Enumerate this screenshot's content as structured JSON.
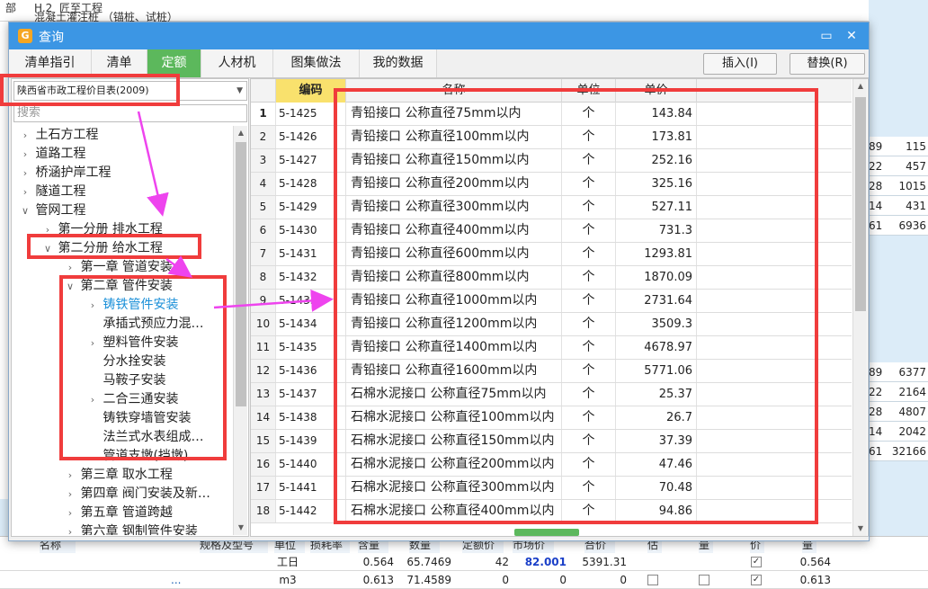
{
  "background": {
    "top_row": {
      "part1": "部",
      "part2": "H.2",
      "part3": "匠至工程",
      "subtitle": "混凝土灌注桩 （锚桩、试桩）"
    },
    "right_values": [
      {
        "a": "89",
        "b": "115"
      },
      {
        "a": "22",
        "b": "457"
      },
      {
        "a": "28",
        "b": "1015"
      },
      {
        "a": "14",
        "b": "431"
      },
      {
        "a": "61",
        "b": "6936"
      }
    ],
    "right_values_lower": [
      {
        "a": "89",
        "b": "6377"
      },
      {
        "a": "22",
        "b": "2164"
      },
      {
        "a": "28",
        "b": "4807"
      },
      {
        "a": "14",
        "b": "2042"
      },
      {
        "a": "61",
        "b": "32166"
      }
    ],
    "grid_headers": [
      "名称",
      "规格及型号",
      "单位",
      "损耗率",
      "含量",
      "数量",
      "定额价",
      "市场价",
      "合价",
      "估",
      "量",
      "价",
      "量"
    ],
    "grid_rows": [
      {
        "name": "",
        "unit": "工日",
        "rate": "",
        "content": "0.564",
        "qty": "65.7469",
        "quota": "42",
        "market": "82.001",
        "total": "5391.31",
        "last": "0.564"
      },
      {
        "name": "...",
        "unit": "m3",
        "rate": "",
        "content": "0.613",
        "qty": "71.4589",
        "quota": "0",
        "market": "0",
        "total": "0",
        "last": "0.613"
      }
    ],
    "colors": {
      "market_value": "#1a3fc8"
    }
  },
  "dialog": {
    "title": "查询",
    "app_icon": "glodon-app-icon",
    "restore_icon": "▭",
    "close_icon": "✕",
    "tabs": [
      {
        "label": "清单指引",
        "active": false
      },
      {
        "label": "清单",
        "active": false
      },
      {
        "label": "定额",
        "active": true
      },
      {
        "label": "人材机",
        "active": false
      },
      {
        "label": "图集做法",
        "active": false
      },
      {
        "label": "我的数据",
        "active": false
      }
    ],
    "insert_button": "插入(I)",
    "replace_button": "替换(R)",
    "library_select": "陕西省市政工程价目表(2009)",
    "search_placeholder": "搜索",
    "tree": [
      {
        "label": "土石方工程",
        "arrow": ">",
        "level": 0
      },
      {
        "label": "道路工程",
        "arrow": ">",
        "level": 0
      },
      {
        "label": "桥涵护岸工程",
        "arrow": ">",
        "level": 0
      },
      {
        "label": "隧道工程",
        "arrow": ">",
        "level": 0
      },
      {
        "label": "管网工程",
        "arrow": "v",
        "level": 0
      },
      {
        "label": "第一分册 排水工程",
        "arrow": ">",
        "level": 1
      },
      {
        "label": "第二分册 给水工程",
        "arrow": "v",
        "level": 1
      },
      {
        "label": "第一章 管道安装",
        "arrow": ">",
        "level": 2
      },
      {
        "label": "第二章 管件安装",
        "arrow": "v",
        "level": 2
      },
      {
        "label": "铸铁管件安装",
        "arrow": ">",
        "level": 3,
        "selected": true
      },
      {
        "label": "承插式预应力混…",
        "arrow": "",
        "level": 3
      },
      {
        "label": "塑料管件安装",
        "arrow": ">",
        "level": 3
      },
      {
        "label": "分水拴安装",
        "arrow": "",
        "level": 3
      },
      {
        "label": "马鞍子安装",
        "arrow": "",
        "level": 3
      },
      {
        "label": "二合三通安装",
        "arrow": ">",
        "level": 3
      },
      {
        "label": "铸铁穿墙管安装",
        "arrow": "",
        "level": 3
      },
      {
        "label": "法兰式水表组成…",
        "arrow": "",
        "level": 3
      },
      {
        "label": "管道支墩(挡墩)",
        "arrow": "",
        "level": 3
      },
      {
        "label": "第三章 取水工程",
        "arrow": ">",
        "level": 2
      },
      {
        "label": "第四章 阀门安装及新…",
        "arrow": ">",
        "level": 2
      },
      {
        "label": "第五章 管道跨越",
        "arrow": ">",
        "level": 2
      },
      {
        "label": "第六章 钢制管件安装",
        "arrow": ">",
        "level": 2
      }
    ],
    "table": {
      "headers": {
        "num": "",
        "code": "编码",
        "name": "名称",
        "unit": "单位",
        "price": "单价"
      },
      "rows": [
        {
          "num": "1",
          "code": "5-1425",
          "name": "青铅接口 公称直径75mm以内",
          "unit": "个",
          "price": "143.84"
        },
        {
          "num": "2",
          "code": "5-1426",
          "name": "青铅接口 公称直径100mm以内",
          "unit": "个",
          "price": "173.81"
        },
        {
          "num": "3",
          "code": "5-1427",
          "name": "青铅接口 公称直径150mm以内",
          "unit": "个",
          "price": "252.16"
        },
        {
          "num": "4",
          "code": "5-1428",
          "name": "青铅接口 公称直径200mm以内",
          "unit": "个",
          "price": "325.16"
        },
        {
          "num": "5",
          "code": "5-1429",
          "name": "青铅接口 公称直径300mm以内",
          "unit": "个",
          "price": "527.11"
        },
        {
          "num": "6",
          "code": "5-1430",
          "name": "青铅接口 公称直径400mm以内",
          "unit": "个",
          "price": "731.3"
        },
        {
          "num": "7",
          "code": "5-1431",
          "name": "青铅接口 公称直径600mm以内",
          "unit": "个",
          "price": "1293.81"
        },
        {
          "num": "8",
          "code": "5-1432",
          "name": "青铅接口 公称直径800mm以内",
          "unit": "个",
          "price": "1870.09"
        },
        {
          "num": "9",
          "code": "5-1433",
          "name": "青铅接口 公称直径1000mm以内",
          "unit": "个",
          "price": "2731.64"
        },
        {
          "num": "10",
          "code": "5-1434",
          "name": "青铅接口 公称直径1200mm以内",
          "unit": "个",
          "price": "3509.3"
        },
        {
          "num": "11",
          "code": "5-1435",
          "name": "青铅接口 公称直径1400mm以内",
          "unit": "个",
          "price": "4678.97"
        },
        {
          "num": "12",
          "code": "5-1436",
          "name": "青铅接口 公称直径1600mm以内",
          "unit": "个",
          "price": "5771.06"
        },
        {
          "num": "13",
          "code": "5-1437",
          "name": "石棉水泥接口 公称直径75mm以内",
          "unit": "个",
          "price": "25.37"
        },
        {
          "num": "14",
          "code": "5-1438",
          "name": "石棉水泥接口 公称直径100mm以内",
          "unit": "个",
          "price": "26.7"
        },
        {
          "num": "15",
          "code": "5-1439",
          "name": "石棉水泥接口 公称直径150mm以内",
          "unit": "个",
          "price": "37.39"
        },
        {
          "num": "16",
          "code": "5-1440",
          "name": "石棉水泥接口 公称直径200mm以内",
          "unit": "个",
          "price": "47.46"
        },
        {
          "num": "17",
          "code": "5-1441",
          "name": "石棉水泥接口 公称直径300mm以内",
          "unit": "个",
          "price": "70.48"
        },
        {
          "num": "18",
          "code": "5-1442",
          "name": "石棉水泥接口 公称直径400mm以内",
          "unit": "个",
          "price": "94.86"
        }
      ]
    },
    "colors": {
      "active_tab": "#5cb85c",
      "titlebar": "#3c96e4",
      "code_header": "#f9e16d",
      "selected_tree": "#1a8fd8",
      "annotation_red": "#f03c3c",
      "annotation_arrow": "#ee44ee"
    }
  }
}
